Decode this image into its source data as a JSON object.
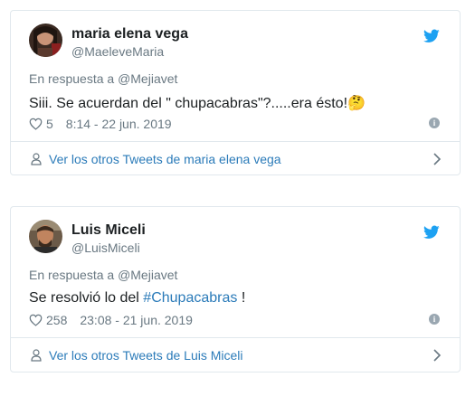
{
  "tweets": [
    {
      "name": "maria elena vega",
      "handle": "@MaeleveMaria",
      "reply_prefix": "En respuesta a ",
      "reply_to": "@Mejiavet",
      "text": "Siii. Se acuerdan del \" chupacabras\"?.....era ésto!",
      "emoji": "🤔",
      "likes": "5",
      "timestamp": "8:14 - 22 jun. 2019",
      "footer_link": "Ver los otros Tweets de maria elena vega"
    },
    {
      "name": "Luis Miceli",
      "handle": "@LuisMiceli",
      "reply_prefix": "En respuesta a ",
      "reply_to": "@Mejiavet",
      "text_before": "Se resolvió lo del ",
      "hashtag": "#Chupacabras",
      "text_after": " !",
      "likes": "258",
      "timestamp": "23:08 - 21 jun. 2019",
      "footer_link": "Ver los otros Tweets de Luis Miceli"
    }
  ],
  "colors": {
    "link": "#2b7bb9",
    "muted": "#697882",
    "border": "#e1e8ed",
    "twitter_blue": "#1da1f2"
  },
  "icons": [
    "twitter-bird-icon",
    "heart-icon",
    "info-icon",
    "user-icon",
    "chevron-right-icon"
  ]
}
